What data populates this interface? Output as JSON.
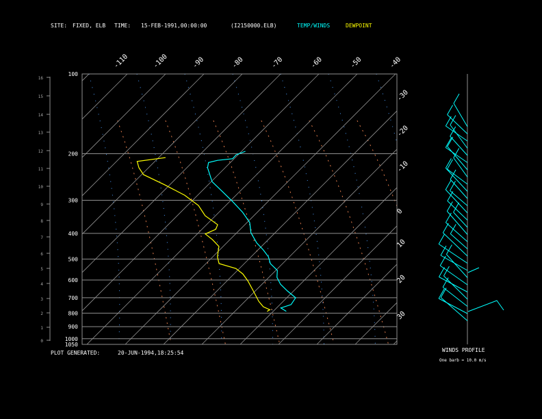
{
  "header": {
    "site_label": "SITE:",
    "site_value": "FIXED, ELB",
    "time_label": "TIME:",
    "time_value": "15-FEB-1991,00:00:00",
    "file": "(I2150000.ELB)",
    "legend_temp": "TEMP/WINDS",
    "legend_dewpoint": "DEWPOINT"
  },
  "footer": {
    "generated_label": "PLOT GENERATED:",
    "generated_value": "20-JUN-1994,18:25:54"
  },
  "winds": {
    "title": "WINDS PROFILE",
    "note": "One barb = 10.0 m/s"
  },
  "colors": {
    "temp": "#00ffff",
    "dewpoint": "#ffff00",
    "grid": "#909090",
    "moist": "#4a9cff",
    "dry": "#e07a4a",
    "background": "#000000"
  },
  "chart_data": {
    "type": "line",
    "subtype": "skew-T log-p",
    "pressure_ticks": [
      "100",
      "200",
      "300",
      "400",
      "500",
      "600",
      "700",
      "800",
      "900",
      "1000",
      "1050"
    ],
    "pressure_values": [
      100,
      200,
      300,
      400,
      500,
      600,
      700,
      800,
      900,
      1000,
      1050
    ],
    "height_ticks_km": [
      "0",
      "1",
      "2",
      "3",
      "4",
      "5",
      "6",
      "7",
      "8",
      "9",
      "10",
      "11",
      "12",
      "13",
      "14",
      "15",
      "16"
    ],
    "temp_ticks_top": [
      "-110",
      "-100",
      "-90",
      "-80",
      "-70",
      "-60",
      "-50",
      "-40"
    ],
    "temp_ticks_right": [
      "-30",
      "-20",
      "-10",
      "0",
      "10",
      "20",
      "30"
    ],
    "ylim_hPa": [
      1050,
      100
    ],
    "y_scale": "log",
    "grid": true,
    "legend": "top",
    "series": [
      {
        "name": "TEMP/WINDS",
        "color": "#00ffff",
        "points": [
          [
            196,
            -59
          ],
          [
            202,
            -60.5
          ],
          [
            209,
            -60.4
          ],
          [
            212,
            -63.9
          ],
          [
            216,
            -65.7
          ],
          [
            226,
            -64.6
          ],
          [
            255,
            -59.8
          ],
          [
            278,
            -54.5
          ],
          [
            304,
            -49.1
          ],
          [
            333,
            -43.8
          ],
          [
            364,
            -39.3
          ],
          [
            398,
            -36.3
          ],
          [
            435,
            -32.1
          ],
          [
            462,
            -28.6
          ],
          [
            490,
            -25.5
          ],
          [
            520,
            -23.2
          ],
          [
            552,
            -19.6
          ],
          [
            586,
            -17.9
          ],
          [
            622,
            -15.2
          ],
          [
            660,
            -11.6
          ],
          [
            700,
            -7.7
          ],
          [
            743,
            -7.1
          ],
          [
            765,
            -8.9
          ],
          [
            788,
            -6.6
          ]
        ]
      },
      {
        "name": "DEWPOINT",
        "color": "#ffff00",
        "points": [
          [
            207,
            -78.2
          ],
          [
            214,
            -84.6
          ],
          [
            226,
            -82.5
          ],
          [
            240,
            -79.5
          ],
          [
            262,
            -71.4
          ],
          [
            287,
            -63.4
          ],
          [
            314,
            -57.1
          ],
          [
            343,
            -52.7
          ],
          [
            371,
            -47.1
          ],
          [
            386,
            -46.4
          ],
          [
            402,
            -47.9
          ],
          [
            422,
            -44.6
          ],
          [
            448,
            -41.1
          ],
          [
            490,
            -38.8
          ],
          [
            520,
            -36.6
          ],
          [
            543,
            -30.9
          ],
          [
            569,
            -27.7
          ],
          [
            604,
            -24.6
          ],
          [
            660,
            -20.5
          ],
          [
            722,
            -16.4
          ],
          [
            757,
            -13.8
          ],
          [
            777,
            -11.3
          ],
          [
            788,
            -11.6
          ]
        ]
      }
    ]
  }
}
